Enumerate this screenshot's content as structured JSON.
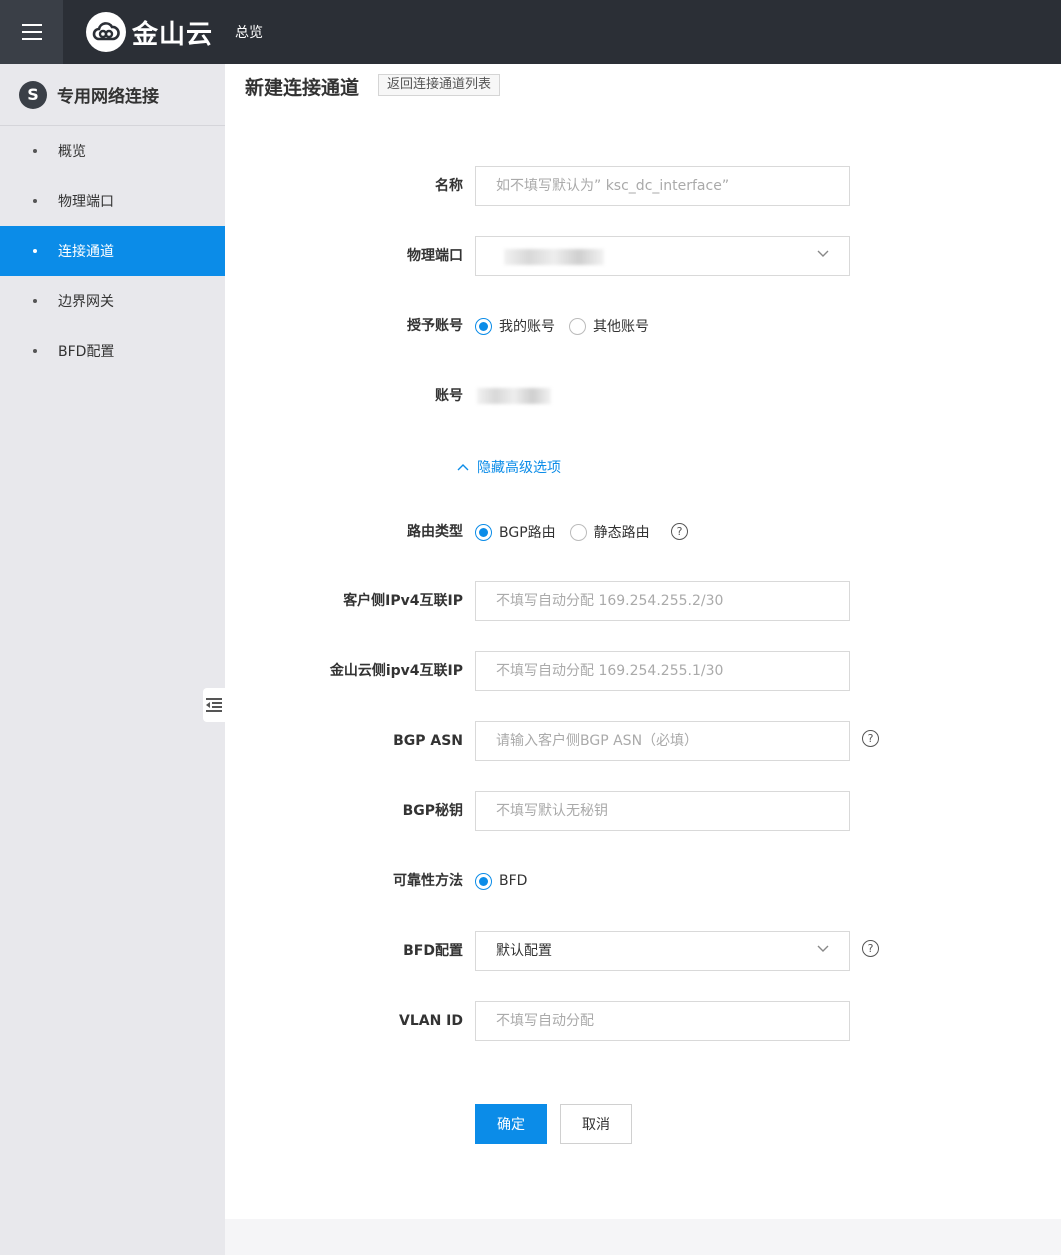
{
  "topbar": {
    "logo_text": "金山云",
    "nav_overview": "总览"
  },
  "sidebar": {
    "title_icon_letter": "S",
    "title": "专用网络连接",
    "items": [
      {
        "label": "概览"
      },
      {
        "label": "物理端口"
      },
      {
        "label": "连接通道",
        "active": true
      },
      {
        "label": "边界网关"
      },
      {
        "label": "BFD配置"
      }
    ]
  },
  "page": {
    "title": "新建连接通道",
    "back_link": "返回连接通道列表"
  },
  "form": {
    "name": {
      "label": "名称",
      "placeholder": "如不填写默认为” ksc_dc_interface”"
    },
    "physical_port": {
      "label": "物理端口"
    },
    "grant_account": {
      "label": "授予账号",
      "options": [
        "我的账号",
        "其他账号"
      ],
      "selected": "我的账号"
    },
    "account": {
      "label": "账号"
    },
    "advanced_toggle": "隐藏高级选项",
    "route_type": {
      "label": "路由类型",
      "options": [
        "BGP路由",
        "静态路由"
      ],
      "selected": "BGP路由"
    },
    "customer_ipv4": {
      "label": "客户侧IPv4互联IP",
      "placeholder": "不填写自动分配 169.254.255.2/30"
    },
    "ksc_ipv4": {
      "label": "金山云侧ipv4互联IP",
      "placeholder": "不填写自动分配 169.254.255.1/30"
    },
    "bgp_asn": {
      "label": "BGP ASN",
      "placeholder": "请输入客户侧BGP ASN（必填）"
    },
    "bgp_key": {
      "label": "BGP秘钥",
      "placeholder": "不填写默认无秘钥"
    },
    "reliability": {
      "label": "可靠性方法",
      "options": [
        "BFD"
      ],
      "selected": "BFD"
    },
    "bfd_config": {
      "label": "BFD配置",
      "value": "默认配置"
    },
    "vlan_id": {
      "label": "VLAN ID",
      "placeholder": "不填写自动分配"
    },
    "help_glyph": "?"
  },
  "actions": {
    "ok": "确定",
    "cancel": "取消"
  },
  "colors": {
    "primary": "#0b8ce8",
    "topbar": "#2b2f36",
    "sidebar": "#e8e8ec"
  }
}
